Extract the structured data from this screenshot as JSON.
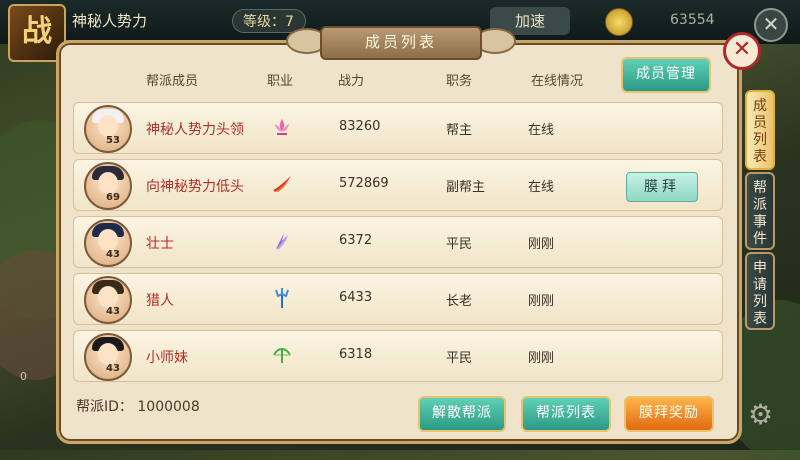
{
  "top_bar": {
    "guild_name": "神秘人势力",
    "level_text": "等级：7",
    "accelerate_label": "加速",
    "coin_value": "63554",
    "emblem_char": "战"
  },
  "panel": {
    "title": "成员列表",
    "manage_button": "成员管理",
    "headers": {
      "member": "帮派成员",
      "job": "职业",
      "power": "战力",
      "role": "职务",
      "online": "在线情况"
    },
    "members": [
      {
        "level": "53",
        "name": "神秘人势力头领",
        "job_icon": "lotus-icon",
        "power": "83260",
        "role": "帮主",
        "online": "在线",
        "worship_label": ""
      },
      {
        "level": "69",
        "name": "向神秘势力低头",
        "job_icon": "flame-blade-icon",
        "power": "572869",
        "role": "副帮主",
        "online": "在线",
        "worship_label": "膜拜"
      },
      {
        "level": "43",
        "name": "壮士",
        "job_icon": "claw-icon",
        "power": "6372",
        "role": "平民",
        "online": "刚刚",
        "worship_label": ""
      },
      {
        "level": "43",
        "name": "猎人",
        "job_icon": "trident-icon",
        "power": "6433",
        "role": "长老",
        "online": "刚刚",
        "worship_label": ""
      },
      {
        "level": "43",
        "name": "小师妹",
        "job_icon": "bow-icon",
        "power": "6318",
        "role": "平民",
        "online": "刚刚",
        "worship_label": ""
      }
    ],
    "guild_id_label": "帮派ID：",
    "guild_id": "1000008",
    "buttons": {
      "disband": "解散帮派",
      "guild_list": "帮派列表",
      "worship_reward": "膜拜奖励"
    }
  },
  "side_tabs": [
    "成员列表",
    "帮派事件",
    "申请列表"
  ],
  "colors": {
    "panel_bg": "#efe3cb",
    "member_name": "#b0302a",
    "teal_button": "#2b9a84",
    "orange_button": "#e06a10"
  }
}
